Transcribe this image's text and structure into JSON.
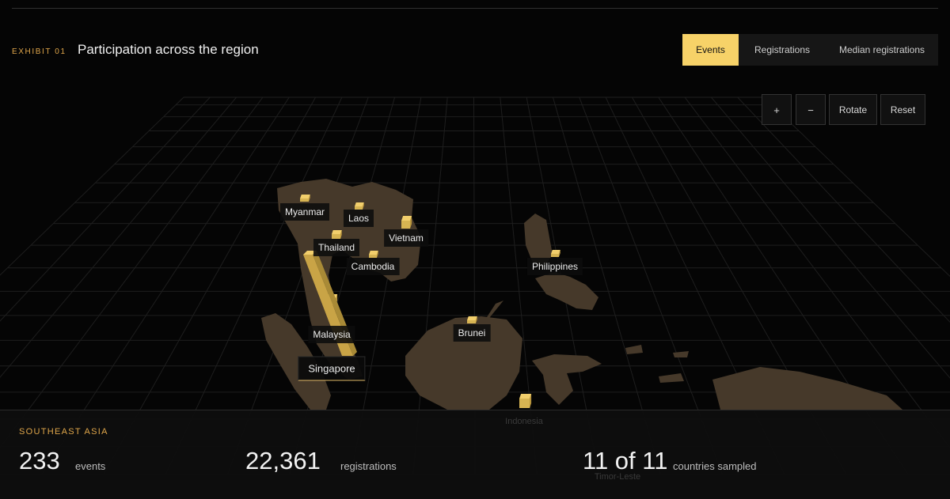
{
  "header": {
    "exhibit": "EXHIBIT 01",
    "title": "Participation across the region"
  },
  "tabs": [
    {
      "label": "Events",
      "active": true
    },
    {
      "label": "Registrations",
      "active": false
    },
    {
      "label": "Median registrations",
      "active": false
    }
  ],
  "controls": {
    "zoom_in": "+",
    "zoom_out": "−",
    "rotate": "Rotate",
    "reset": "Reset"
  },
  "map": {
    "colors": {
      "land": "#46392a",
      "grid": "#1e1e1e",
      "bar": "#f2cf6c",
      "accent": "#e0a64a"
    },
    "labels": [
      "Myanmar",
      "Laos",
      "Vietnam",
      "Thailand",
      "Cambodia",
      "Philippines",
      "Malaysia",
      "Brunei",
      "Singapore",
      "Indonesia",
      "Timor-Leste"
    ],
    "selected": "Singapore"
  },
  "summary": {
    "region": "SOUTHEAST ASIA",
    "events_value": "233",
    "events_label": "events",
    "registrations_value": "22,361",
    "registrations_label": "registrations",
    "countries_value": "11 of 11",
    "countries_label": "countries sampled"
  }
}
